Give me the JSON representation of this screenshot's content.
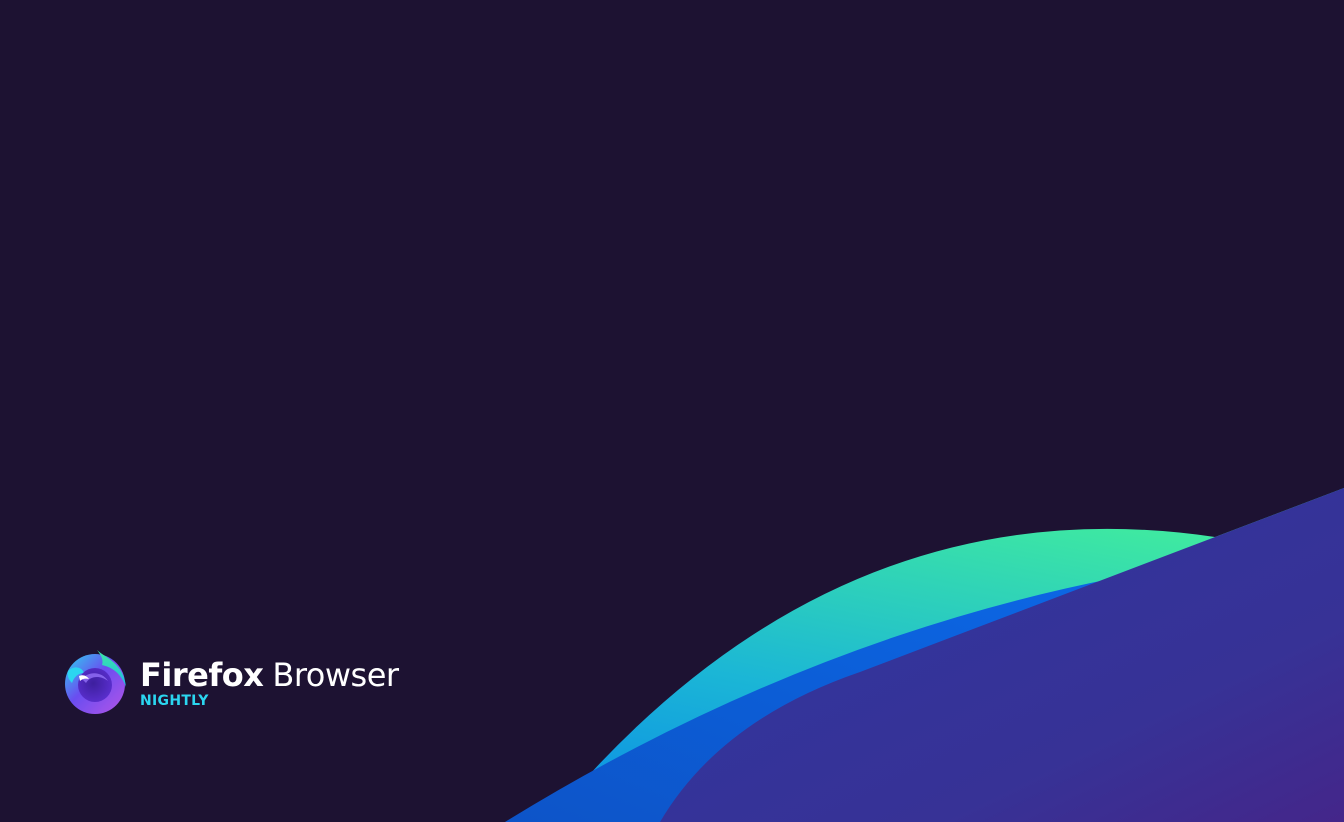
{
  "app": {
    "brand_primary": "Firefox",
    "brand_secondary": "Browser",
    "channel": "NIGHTLY"
  },
  "colors": {
    "background": "#1d1232",
    "channel_text": "#2bd6f0",
    "wave_green": "#3ee8a2",
    "wave_blue": "#0a66e0",
    "wave_indigo": "#3a3194",
    "wave_purple": "#44268a"
  },
  "icons": {
    "logo": "firefox-nightly-logo-icon"
  }
}
